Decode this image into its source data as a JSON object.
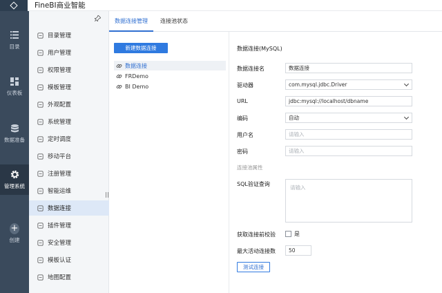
{
  "app": {
    "title": "FineBI商业智能"
  },
  "rail": {
    "items": [
      {
        "label": "目录",
        "icon": "list-icon"
      },
      {
        "label": "仪表板",
        "icon": "dashboard-icon"
      },
      {
        "label": "数据准备",
        "icon": "database-icon"
      },
      {
        "label": "管理系统",
        "icon": "gear-icon",
        "active": true
      },
      {
        "label": "创建",
        "icon": "plus-icon"
      }
    ]
  },
  "menu": {
    "items": [
      {
        "label": "目录管理",
        "icon": "catalog-icon"
      },
      {
        "label": "用户管理",
        "icon": "user-icon"
      },
      {
        "label": "权限管理",
        "icon": "lock-icon"
      },
      {
        "label": "模板管理",
        "icon": "template-icon"
      },
      {
        "label": "外观配置",
        "icon": "appearance-icon"
      },
      {
        "label": "系统管理",
        "icon": "system-icon"
      },
      {
        "label": "定时调度",
        "icon": "clock-icon"
      },
      {
        "label": "移动平台",
        "icon": "mobile-icon"
      },
      {
        "label": "注册管理",
        "icon": "register-icon"
      },
      {
        "label": "智能运维",
        "icon": "ops-icon"
      },
      {
        "label": "数据连接",
        "icon": "folder-icon",
        "active": true
      },
      {
        "label": "插件管理",
        "icon": "plugin-icon"
      },
      {
        "label": "安全管理",
        "icon": "shield-icon"
      },
      {
        "label": "模板认证",
        "icon": "certify-icon"
      },
      {
        "label": "地图配置",
        "icon": "map-icon"
      }
    ]
  },
  "tabs": [
    {
      "label": "数据连接管理",
      "active": true
    },
    {
      "label": "连接池状态"
    }
  ],
  "connections": {
    "new_button": "新建数据连接",
    "items": [
      {
        "label": "数据连接",
        "active": true
      },
      {
        "label": "FRDemo"
      },
      {
        "label": "BI Demo"
      }
    ]
  },
  "form": {
    "title": "数据连接(MySQL)",
    "name_label": "数据连接名",
    "name_value": "数据连接",
    "driver_label": "驱动器",
    "driver_value": "com.mysql.jdbc.Driver",
    "url_label": "URL",
    "url_value": "jdbc:mysql://localhost/dbname",
    "encoding_label": "编码",
    "encoding_value": "自动",
    "username_label": "用户名",
    "username_placeholder": "请输入",
    "password_label": "密码",
    "password_placeholder": "请输入",
    "pool_section": "连接池属性",
    "sql_label": "SQL验证查询",
    "sql_placeholder": "请输入",
    "validate_label": "获取连接前校验",
    "validate_option": "是",
    "validate_checked": false,
    "max_active_label": "最大活动连接数",
    "max_active_value": "50",
    "test_button": "测试连接"
  },
  "colors": {
    "accent": "#2f7ae0",
    "rail": "#3a4a5c",
    "menu_active": "#dde8f7"
  }
}
